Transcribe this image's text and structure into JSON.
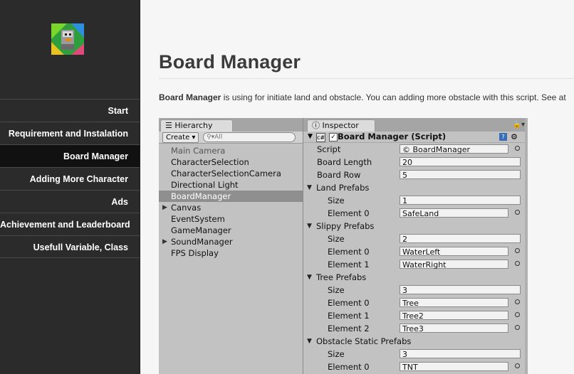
{
  "sidebar": {
    "items": [
      {
        "label": "Start",
        "active": false
      },
      {
        "label": "Requirement and Instalation",
        "active": false
      },
      {
        "label": "Board Manager",
        "active": true
      },
      {
        "label": "Adding More Character",
        "active": false
      },
      {
        "label": "Ads",
        "active": false
      },
      {
        "label": "Achievement and Leaderboard",
        "active": false
      },
      {
        "label": "Usefull Variable, Class",
        "active": false
      }
    ]
  },
  "main": {
    "title": "Board Manager",
    "intro_bold": "Board Manager",
    "intro_rest": " is using for initiate land and obstacle. You can adding more obstacle with this script. See at"
  },
  "hierarchy": {
    "tab": "Hierarchy",
    "create": "Create",
    "search_placeholder": "All",
    "items": [
      {
        "label": "Main Camera",
        "dim": true
      },
      {
        "label": "CharacterSelection"
      },
      {
        "label": "CharacterSelectionCamera"
      },
      {
        "label": "Directional Light"
      },
      {
        "label": "BoardManager",
        "selected": true
      },
      {
        "label": "Canvas",
        "foldout": true
      },
      {
        "label": "EventSystem"
      },
      {
        "label": "GameManager"
      },
      {
        "label": "SoundManager",
        "foldout": true
      },
      {
        "label": "FPS Display"
      }
    ]
  },
  "inspector": {
    "tab": "Inspector",
    "component": "Board Manager (Script)",
    "properties": [
      {
        "label": "Script",
        "level": 1,
        "value": "BoardManager",
        "kind": "script"
      },
      {
        "label": "Board Length",
        "level": 1,
        "value": "20",
        "kind": "text"
      },
      {
        "label": "Board Row",
        "level": 1,
        "value": "5",
        "kind": "text"
      },
      {
        "label": "Land Prefabs",
        "level": 0,
        "kind": "fold"
      },
      {
        "label": "Size",
        "level": 2,
        "value": "1",
        "kind": "text"
      },
      {
        "label": "Element 0",
        "level": 2,
        "value": "SafeLand",
        "kind": "obj"
      },
      {
        "label": "Slippy Prefabs",
        "level": 0,
        "kind": "fold"
      },
      {
        "label": "Size",
        "level": 2,
        "value": "2",
        "kind": "text"
      },
      {
        "label": "Element 0",
        "level": 2,
        "value": "WaterLeft",
        "kind": "obj"
      },
      {
        "label": "Element 1",
        "level": 2,
        "value": "WaterRight",
        "kind": "obj"
      },
      {
        "label": "Tree Prefabs",
        "level": 0,
        "kind": "fold"
      },
      {
        "label": "Size",
        "level": 2,
        "value": "3",
        "kind": "text"
      },
      {
        "label": "Element 0",
        "level": 2,
        "value": "Tree",
        "kind": "obj"
      },
      {
        "label": "Element 1",
        "level": 2,
        "value": "Tree2",
        "kind": "obj"
      },
      {
        "label": "Element 2",
        "level": 2,
        "value": "Tree3",
        "kind": "obj"
      },
      {
        "label": "Obstacle Static Prefabs",
        "level": 0,
        "kind": "fold"
      },
      {
        "label": "Size",
        "level": 2,
        "value": "3",
        "kind": "text"
      },
      {
        "label": "Element 0",
        "level": 2,
        "value": "TNT",
        "kind": "obj"
      }
    ]
  }
}
